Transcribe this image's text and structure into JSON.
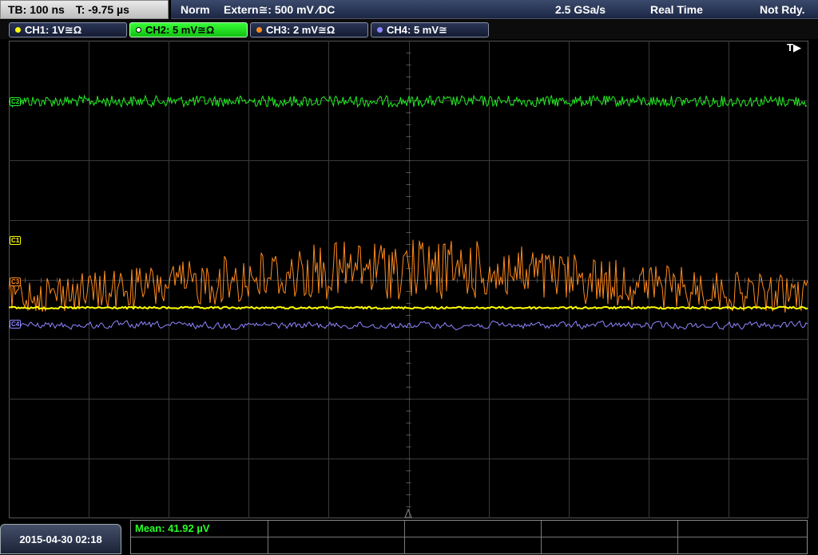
{
  "status": {
    "timebase": "TB: 100 ns",
    "time_offset": "T: -9.75 µs",
    "trigger_mode": "Norm",
    "trigger_source": "Extern≅: 500 mV ⁄DC",
    "sample_rate": "2.5 GSa/s",
    "acq_mode": "Real Time",
    "ready_state": "Not Rdy."
  },
  "channels": [
    {
      "label": "CH1: 1V≅Ω",
      "color": "#ffff00",
      "marker": "C1",
      "active": false
    },
    {
      "label": "CH2: 5 mV≅Ω",
      "color": "#22ee22",
      "marker": "C2",
      "active": true
    },
    {
      "label": "CH3: 2 mV≅Ω",
      "color": "#ff8a1c",
      "marker": "C3",
      "active": false
    },
    {
      "label": "CH4: 5 mV≅",
      "color": "#8f85ff",
      "marker": "C4",
      "active": false
    }
  ],
  "trigger_indicator": "T▶",
  "measurement": {
    "text": "Mean: 41.92 µV"
  },
  "datetime": "2015-04-30 02:18"
}
